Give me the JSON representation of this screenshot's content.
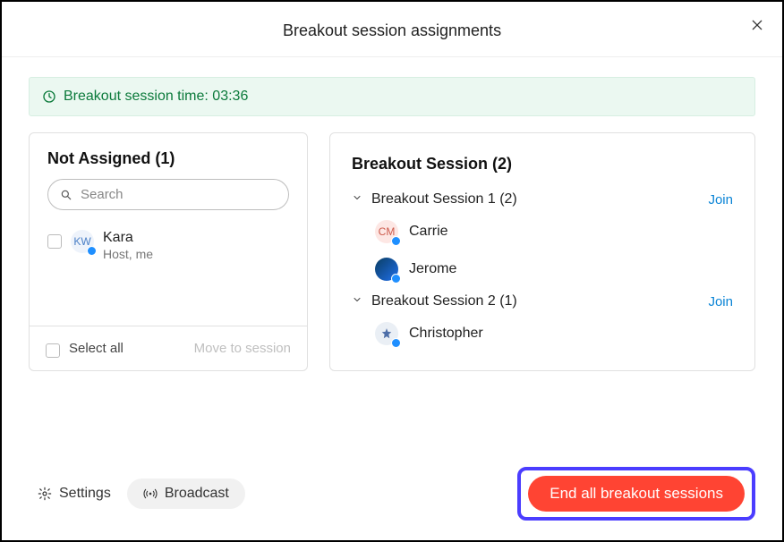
{
  "header": {
    "title": "Breakout session assignments"
  },
  "banner": {
    "text": "Breakout session time: 03:36"
  },
  "left": {
    "title": "Not Assigned (1)",
    "search_placeholder": "Search",
    "user": {
      "name": "Kara",
      "sub": "Host, me",
      "initials": "KW"
    },
    "select_all": "Select all",
    "move": "Move to session"
  },
  "right": {
    "title": "Breakout Session  (2)",
    "join_label": "Join",
    "session1": {
      "name": "Breakout Session 1 (2)",
      "p1": "Carrie",
      "p1_initials": "CM",
      "p2": "Jerome"
    },
    "session2": {
      "name": "Breakout Session 2 (1)",
      "p1": "Christopher"
    }
  },
  "footer": {
    "settings": "Settings",
    "broadcast": "Broadcast",
    "end": "End all breakout sessions"
  }
}
